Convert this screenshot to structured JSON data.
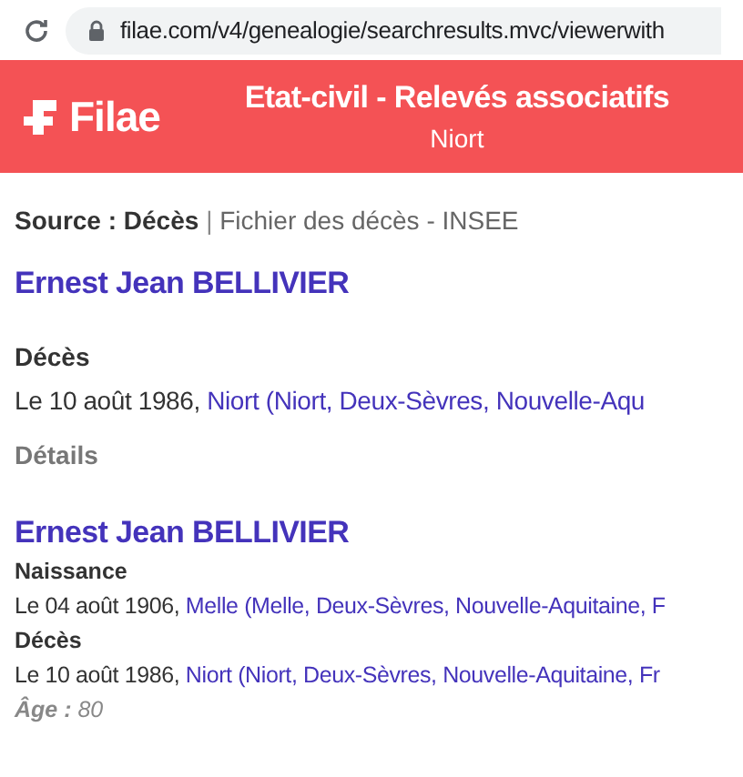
{
  "browser": {
    "url": "filae.com/v4/genealogie/searchresults.mvc/viewerwith"
  },
  "header": {
    "logo": "Filae",
    "title": "Etat-civil - Relevés associatifs",
    "subtitle": "Niort"
  },
  "source": {
    "label": "Source : Décès",
    "separator": "|",
    "value": "Fichier des décès - INSEE"
  },
  "records": [
    {
      "kind": "large",
      "name": "Ernest Jean BELLIVIER",
      "events": [
        {
          "label": "Décès",
          "date": "Le 10 août 1986,",
          "place": "Niort (Niort, Deux-Sèvres, Nouvelle-Aqu"
        }
      ],
      "details": "Détails"
    },
    {
      "kind": "compact",
      "name": "Ernest Jean BELLIVIER",
      "events": [
        {
          "label": "Naissance",
          "date": "Le 04 août 1906,",
          "place": "Melle (Melle, Deux-Sèvres, Nouvelle-Aquitaine, F"
        },
        {
          "label": "Décès",
          "date": "Le 10 août 1986,",
          "place": "Niort (Niort, Deux-Sèvres, Nouvelle-Aquitaine, Fr"
        }
      ],
      "age_label": "Âge :",
      "age": "80"
    }
  ]
}
